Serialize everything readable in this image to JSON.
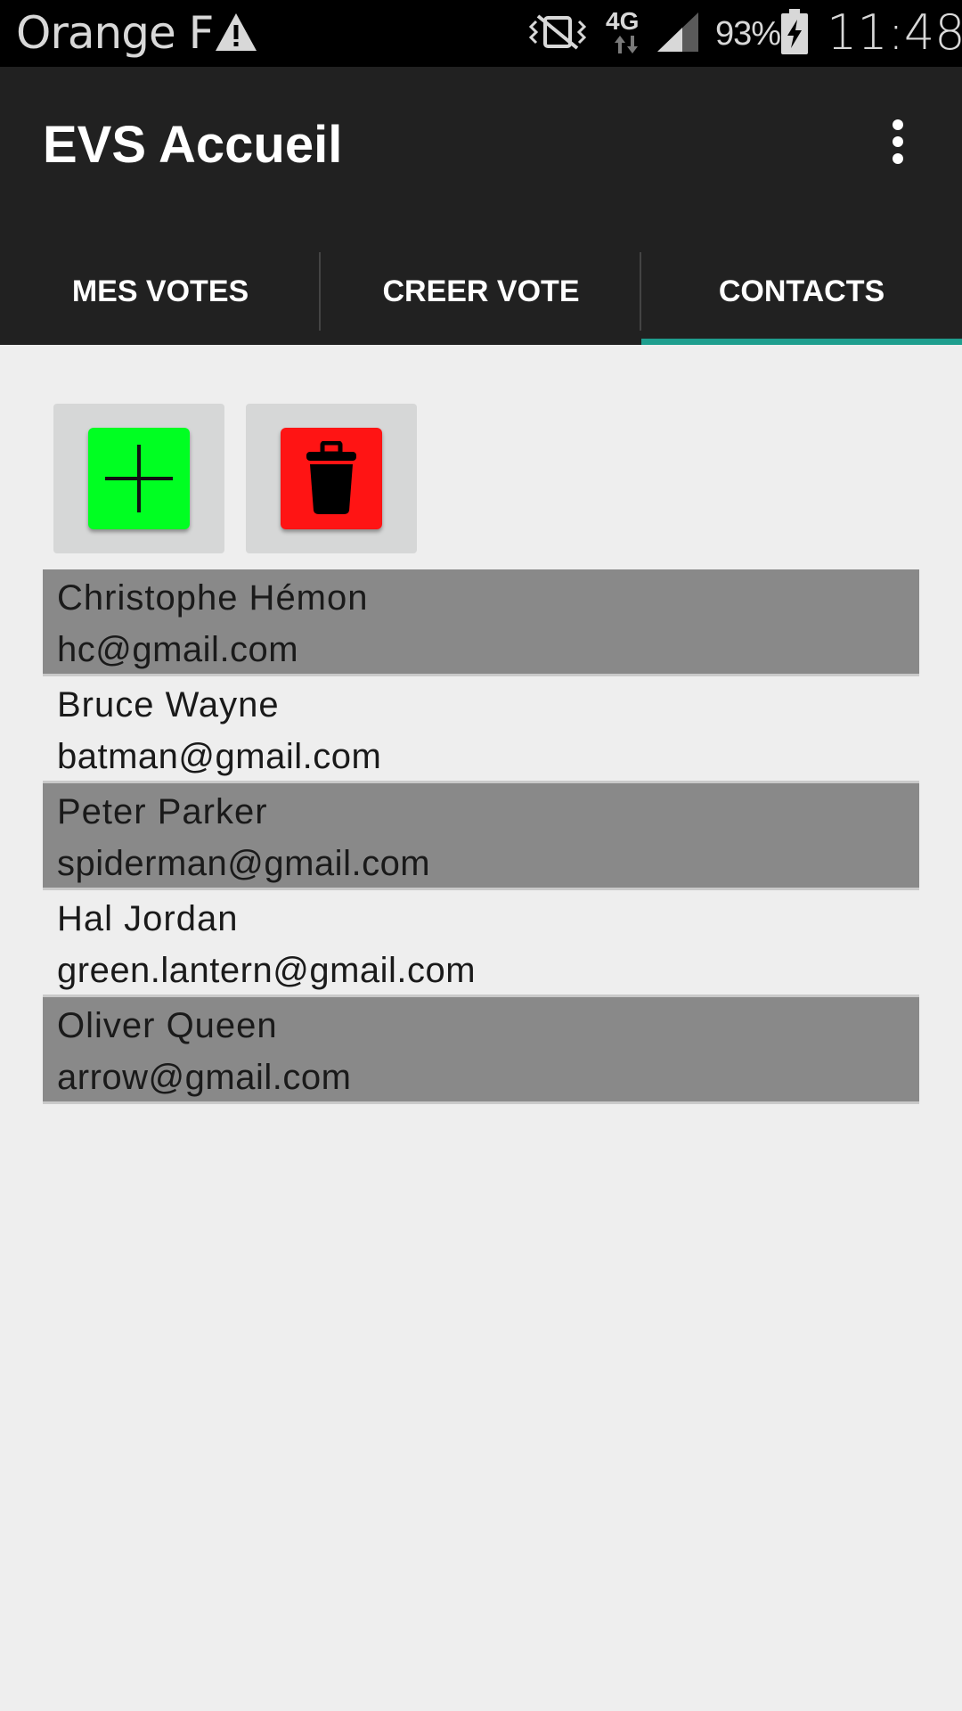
{
  "status_bar": {
    "carrier": "Orange F",
    "network_type": "4G",
    "battery": "93%",
    "time": "11:48",
    "icons": [
      "warning-icon",
      "vibrate-icon",
      "data-arrows-icon",
      "signal-icon",
      "battery-charging-icon"
    ]
  },
  "app_bar": {
    "title": "EVS Accueil",
    "menu_icon": "more-vertical-icon"
  },
  "tabs": [
    {
      "label": "MES VOTES",
      "selected": false
    },
    {
      "label": "CREER VOTE",
      "selected": false
    },
    {
      "label": "CONTACTS",
      "selected": true
    }
  ],
  "tab_indicator_color": "#1e9e8e",
  "actions": {
    "add": {
      "icon": "plus-icon",
      "color": "#00ff22"
    },
    "delete": {
      "icon": "trash-icon",
      "color": "#ff1414"
    }
  },
  "contacts": [
    {
      "name": "Christophe Hémon",
      "email": "hc@gmail.com"
    },
    {
      "name": "Bruce Wayne",
      "email": "batman@gmail.com"
    },
    {
      "name": "Peter Parker",
      "email": "spiderman@gmail.com"
    },
    {
      "name": "Hal Jordan",
      "email": "green.lantern@gmail.com"
    },
    {
      "name": "Oliver Queen",
      "email": "arrow@gmail.com"
    }
  ]
}
